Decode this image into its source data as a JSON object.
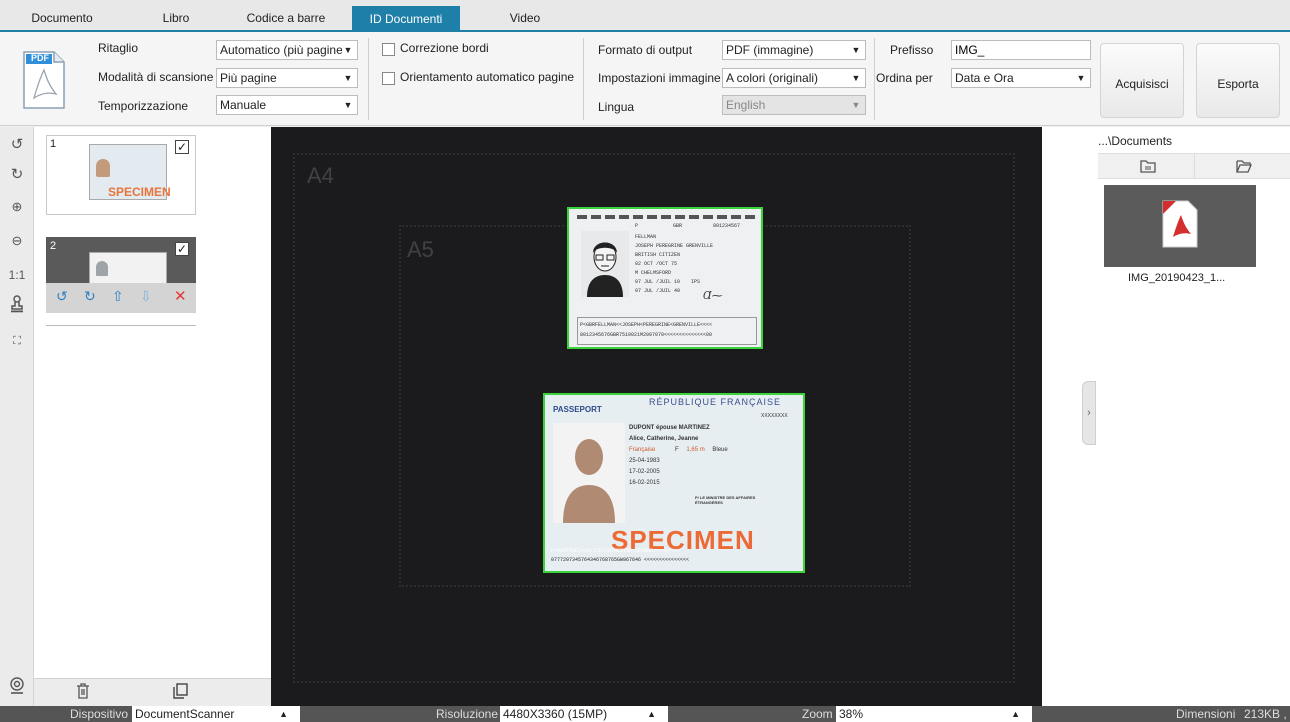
{
  "tabs": [
    {
      "label": "Documento",
      "active": false
    },
    {
      "label": "Libro",
      "active": false
    },
    {
      "label": "Codice a barre",
      "active": false
    },
    {
      "label": "ID Documenti",
      "active": true
    },
    {
      "label": "Video",
      "active": false
    }
  ],
  "toolbar": {
    "pdf_icon_text": "PDF",
    "crop_label": "Ritaglio",
    "crop_value": "Automatico (più pagine",
    "scan_mode_label": "Modalità di scansione",
    "scan_mode_value": "Più pagine",
    "timing_label": "Temporizzazione",
    "timing_value": "Manuale",
    "edge_correction_label": "Correzione bordi",
    "auto_orientation_label": "Orientamento automatico pagine",
    "output_format_label": "Formato di output",
    "output_format_value": "PDF (immagine)",
    "image_settings_label": "Impostazioni immagine",
    "image_settings_value": "A colori (originali)",
    "language_label": "Lingua",
    "language_value": "English",
    "prefix_label": "Prefisso",
    "prefix_value": "IMG_",
    "sort_label": "Ordina per",
    "sort_value": "Data e Ora",
    "acquire_label": "Acquisisci",
    "export_label": "Esporta"
  },
  "thumbnails": [
    {
      "number": "1",
      "checked": true,
      "stamp": "SPECIMEN"
    },
    {
      "number": "2",
      "checked": true
    }
  ],
  "canvas": {
    "paper_a4": "A4",
    "paper_a5": "A5",
    "uk_id": {
      "number": "801234567",
      "type": "P",
      "code": "GBR",
      "surname": "FELLMAN",
      "given_names": "JOSEPH PEREGRINE GRENVILLE",
      "nationality": "BRITISH CITIZEN",
      "dob": "02 OCT /OCT 75",
      "sex_place": "M    CHELMSFORD",
      "issue": "07 JUL /JUIL 10",
      "authority": "IPS",
      "expiry": "07 JUL /JUIL 40",
      "mrz1": "P<GBRFELLMAN<<JOSEPH<PEREGRINE<GRENVILLE<<<<",
      "mrz2": "8012345676GBR7510021M2007070<<<<<<<<<<<<<<00"
    },
    "fr_passport": {
      "title": "PASSEPORT",
      "country": "RÉPUBLIQUE FRANÇAISE",
      "number": "XXXXXXXX",
      "surname": "DUPONT épouse MARTINEZ",
      "given_names": "Alice, Catherine, Jeanne",
      "nationality": "Française",
      "sex": "F",
      "height": "1,65 m",
      "eyes": "Bleue",
      "dob": "25-04-1983",
      "issue": "17-02-2005",
      "expiry": "16-02-2015",
      "authority": "P/ LE MINISTRE DES AFFAIRES ÉTRANGÈRES",
      "stamp": "SPECIMEN",
      "mrz1": "P<MARTINEZ<<ALICE<CATHERINE<JEANNE<<<<<<<<<",
      "mrz2": "0777207345764346768765GW967646 <<<<<<<<<<<<<<<"
    }
  },
  "right_panel": {
    "path": "...\\Documents",
    "file_name": "IMG_20190423_1..."
  },
  "status": {
    "device_label": "Dispositivo",
    "device_value": "DocumentScanner",
    "resolution_label": "Risoluzione",
    "resolution_value": "4480X3360 (15MP)",
    "zoom_label": "Zoom",
    "zoom_value": "38%",
    "size_label": "Dimensioni",
    "size_value": "213KB ,"
  },
  "colors": {
    "accent": "#1e7fa8",
    "detect_border": "#39d33a",
    "delete": "#e53935"
  }
}
